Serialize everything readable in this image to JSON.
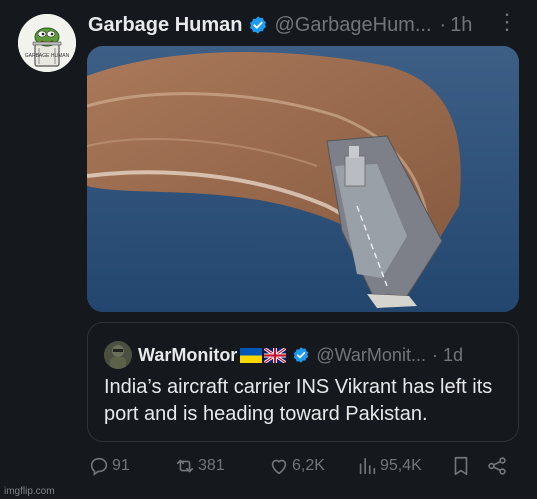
{
  "post": {
    "author_name": "Garbage Human",
    "author_handle": "@GarbageHum...",
    "separator": "·",
    "time": "1h",
    "more_icon": "more-icon",
    "avatar_text": "GARBAGE HUMAN",
    "media_icon": "aircraft-carrier-photo"
  },
  "quote": {
    "author_name": "WarMonitor",
    "flags": [
      "ukraine-flag",
      "uk-flag"
    ],
    "author_handle": "@WarMonit...",
    "separator": "·",
    "time": "1d",
    "text": "India’s aircraft carrier INS Vikrant has left its port and is heading toward Pakistan."
  },
  "actions": {
    "replies": "91",
    "reposts": "381",
    "likes": "6,2K",
    "views": "95,4K"
  },
  "watermark": "imgflip.com",
  "colors": {
    "background": "#15181c",
    "text": "#e7e9ea",
    "muted": "#71767b",
    "verified": "#1d9bf0"
  }
}
